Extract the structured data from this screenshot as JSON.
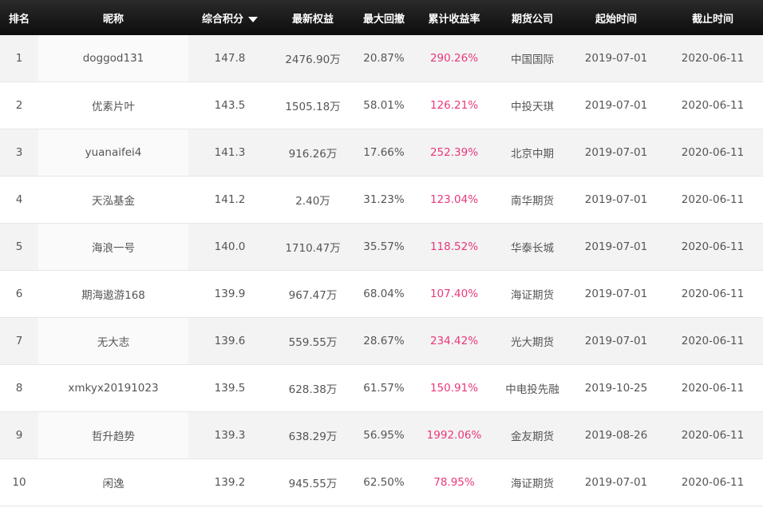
{
  "headers": {
    "rank": "排名",
    "nickname": "昵称",
    "score": "综合积分",
    "equity": "最新权益",
    "drawdown": "最大回撤",
    "return": "累计收益率",
    "company": "期货公司",
    "start": "起始时间",
    "end": "截止时间"
  },
  "sort_icon": "caret-down-icon",
  "accent_color": "#e8387c",
  "rows": [
    {
      "rank": "1",
      "nickname": "doggod131",
      "score": "147.8",
      "equity": "2476.90万",
      "drawdown": "20.87%",
      "return": "290.26%",
      "company": "中国国际",
      "start": "2019-07-01",
      "end": "2020-06-11"
    },
    {
      "rank": "2",
      "nickname": "优素片叶",
      "score": "143.5",
      "equity": "1505.18万",
      "drawdown": "58.01%",
      "return": "126.21%",
      "company": "中投天琪",
      "start": "2019-07-01",
      "end": "2020-06-11"
    },
    {
      "rank": "3",
      "nickname": "yuanaifei4",
      "score": "141.3",
      "equity": "916.26万",
      "drawdown": "17.66%",
      "return": "252.39%",
      "company": "北京中期",
      "start": "2019-07-01",
      "end": "2020-06-11"
    },
    {
      "rank": "4",
      "nickname": "天泓基金",
      "score": "141.2",
      "equity": "2.40万",
      "drawdown": "31.23%",
      "return": "123.04%",
      "company": "南华期货",
      "start": "2019-07-01",
      "end": "2020-06-11"
    },
    {
      "rank": "5",
      "nickname": "海浪一号",
      "score": "140.0",
      "equity": "1710.47万",
      "drawdown": "35.57%",
      "return": "118.52%",
      "company": "华泰长城",
      "start": "2019-07-01",
      "end": "2020-06-11"
    },
    {
      "rank": "6",
      "nickname": "期海遨游168",
      "score": "139.9",
      "equity": "967.47万",
      "drawdown": "68.04%",
      "return": "107.40%",
      "company": "海证期货",
      "start": "2019-07-01",
      "end": "2020-06-11"
    },
    {
      "rank": "7",
      "nickname": "无大志",
      "score": "139.6",
      "equity": "559.55万",
      "drawdown": "28.67%",
      "return": "234.42%",
      "company": "光大期货",
      "start": "2019-07-01",
      "end": "2020-06-11"
    },
    {
      "rank": "8",
      "nickname": "xmkyx20191023",
      "score": "139.5",
      "equity": "628.38万",
      "drawdown": "61.57%",
      "return": "150.91%",
      "company": "中电投先融",
      "start": "2019-10-25",
      "end": "2020-06-11"
    },
    {
      "rank": "9",
      "nickname": "哲升趋势",
      "score": "139.3",
      "equity": "638.29万",
      "drawdown": "56.95%",
      "return": "1992.06%",
      "company": "金友期货",
      "start": "2019-08-26",
      "end": "2020-06-11"
    },
    {
      "rank": "10",
      "nickname": "闲逸",
      "score": "139.2",
      "equity": "945.55万",
      "drawdown": "62.50%",
      "return": "78.95%",
      "company": "海证期货",
      "start": "2019-07-01",
      "end": "2020-06-11"
    }
  ]
}
